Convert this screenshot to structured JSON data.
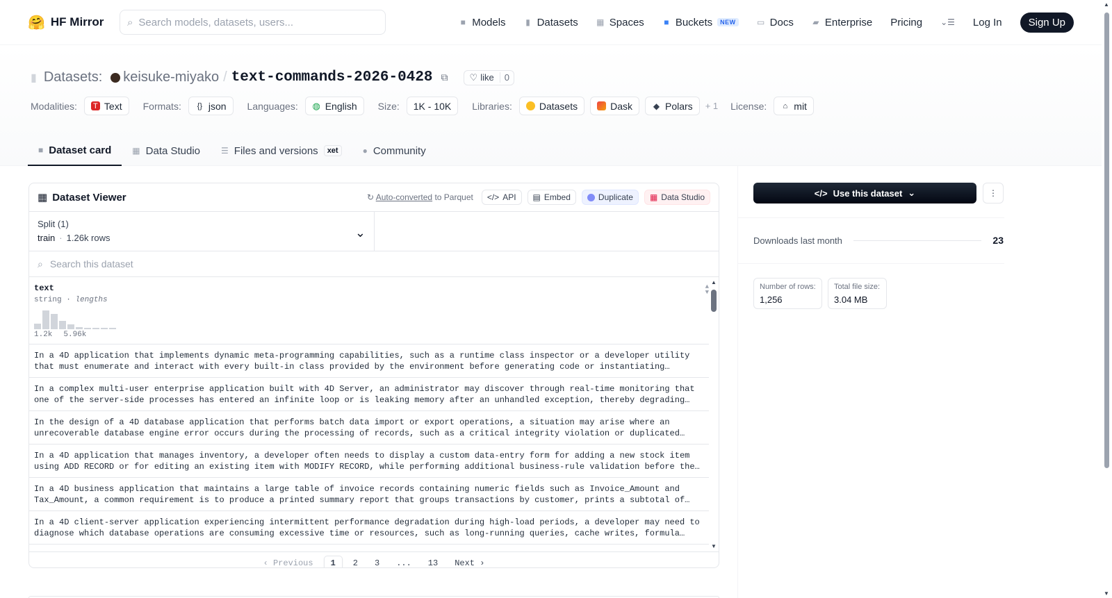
{
  "nav": {
    "brand": "HF Mirror",
    "search_placeholder": "Search models, datasets, users...",
    "links": {
      "models": "Models",
      "datasets": "Datasets",
      "spaces": "Spaces",
      "buckets": "Buckets",
      "buckets_badge": "NEW",
      "docs": "Docs",
      "enterprise": "Enterprise",
      "pricing": "Pricing"
    },
    "login": "Log In",
    "signup": "Sign Up"
  },
  "repo": {
    "kind_label": "Datasets:",
    "owner": "keisuke-miyako",
    "separator": "/",
    "name": "text-commands-2026-0428",
    "like_label": "like",
    "like_count": "0"
  },
  "meta": {
    "modalities_label": "Modalities:",
    "modality": "Text",
    "formats_label": "Formats:",
    "format": "json",
    "languages_label": "Languages:",
    "language": "English",
    "size_label": "Size:",
    "size": "1K - 10K",
    "libraries_label": "Libraries:",
    "libraries": [
      "Datasets",
      "Dask",
      "Polars"
    ],
    "libraries_more": "+ 1",
    "license_label": "License:",
    "license": "mit"
  },
  "tabs": {
    "dataset_card": "Dataset card",
    "data_studio": "Data Studio",
    "files": "Files and versions",
    "files_badge": "xet",
    "community": "Community"
  },
  "viewer": {
    "title": "Dataset Viewer",
    "autoconv_link": "Auto-converted",
    "autoconv_rest": "to Parquet",
    "api": "API",
    "embed": "Embed",
    "duplicate": "Duplicate",
    "data_studio": "Data Studio",
    "split_label": "Split (1)",
    "split_name": "train",
    "split_rows": "1.26k rows",
    "search_placeholder": "Search this dataset",
    "column": {
      "name": "text",
      "type": "string",
      "type_suffix": "lengths",
      "min_label": "1.2k",
      "max_label": "5.96k",
      "histogram": [
        0.3,
        0.95,
        0.8,
        0.42,
        0.25,
        0.12,
        0.05,
        0.05,
        0.05,
        0.05
      ]
    },
    "rows": [
      [
        "In a 4D application that implements dynamic meta-programming capabilities, such as a runtime class inspector or a developer utility",
        "that must enumerate and interact with every built-in class provided by the environment before generating code or instantiating…"
      ],
      [
        "In a complex multi-user enterprise application built with 4D Server, an administrator may discover through real-time monitoring that",
        "one of the server-side processes has entered an infinite loop or is leaking memory after an unhandled exception, thereby degrading…"
      ],
      [
        "In the design of a 4D database application that performs batch data import or export operations, a situation may arise where an",
        "unrecoverable database engine error occurs during the processing of records, such as a critical integrity violation or duplicated…"
      ],
      [
        "In a 4D application that manages inventory, a developer often needs to display a custom data-entry form for adding a new stock item",
        "using ADD RECORD or for editing an existing item with MODIFY RECORD, while performing additional business-rule validation before the…"
      ],
      [
        "In a 4D business application that maintains a large table of invoice records containing numeric fields such as Invoice_Amount and",
        "Tax_Amount, a common requirement is to produce a printed summary report that groups transactions by customer, prints a subtotal of…"
      ],
      [
        "In a 4D client-server application experiencing intermittent performance degradation during high-load periods, a developer may need to",
        "diagnose which database operations are consuming excessive time or resources, such as long-running queries, cache writes, formula…"
      ]
    ],
    "pager": {
      "prev": "Previous",
      "pages": [
        "1",
        "2",
        "3",
        "...",
        "13"
      ],
      "current": "1",
      "next": "Next"
    }
  },
  "sidebar": {
    "use_button": "Use this dataset",
    "downloads_label": "Downloads last month",
    "downloads_value": "23",
    "rows_label": "Number of rows:",
    "rows_value": "1,256",
    "size_label": "Total file size:",
    "size_value": "3.04 MB"
  }
}
